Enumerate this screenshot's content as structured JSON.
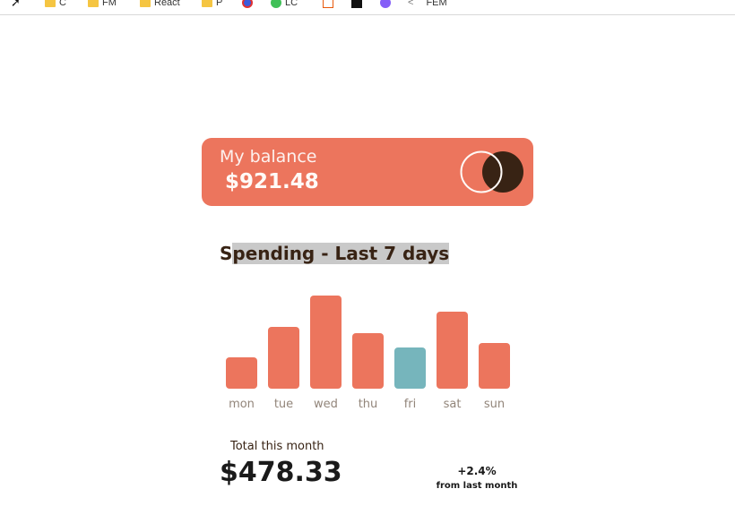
{
  "bookmarks": [
    {
      "icon": "cursor-icon",
      "label": ""
    },
    {
      "icon": "folder-icon",
      "label": "C"
    },
    {
      "icon": "folder-icon",
      "label": "FM"
    },
    {
      "icon": "folder-icon",
      "label": "React"
    },
    {
      "icon": "folder-icon",
      "label": "P"
    },
    {
      "icon": "site-icon-red-badge",
      "label": ""
    },
    {
      "icon": "site-icon-green",
      "label": "LC"
    },
    {
      "icon": "document-icon",
      "label": ""
    },
    {
      "icon": "terminal-icon",
      "label": ""
    },
    {
      "icon": "shield-icon",
      "label": ""
    },
    {
      "icon": "chevron-icon",
      "label": "FEM"
    }
  ],
  "balance": {
    "label": "My balance",
    "value": "$921.48"
  },
  "spending": {
    "title_first": "S",
    "title_rest": "pending - Last 7 days"
  },
  "chart_data": {
    "type": "bar",
    "categories": [
      "mon",
      "tue",
      "wed",
      "thu",
      "fri",
      "sat",
      "sun"
    ],
    "values": [
      17.45,
      34.91,
      52.36,
      31.07,
      23.39,
      43.28,
      25.48
    ],
    "highlight_index": 4,
    "ylim": [
      0,
      52.36
    ],
    "colors": {
      "bar": "#ec755d",
      "highlight": "#76b5bc"
    }
  },
  "summary": {
    "total_label": "Total this month",
    "total_value": "$478.33",
    "change_pct": "+2.4%",
    "change_label": "from last month"
  },
  "colors": {
    "card": "#ec755d",
    "logo_dark": "#382314",
    "text_dark": "#382314"
  }
}
